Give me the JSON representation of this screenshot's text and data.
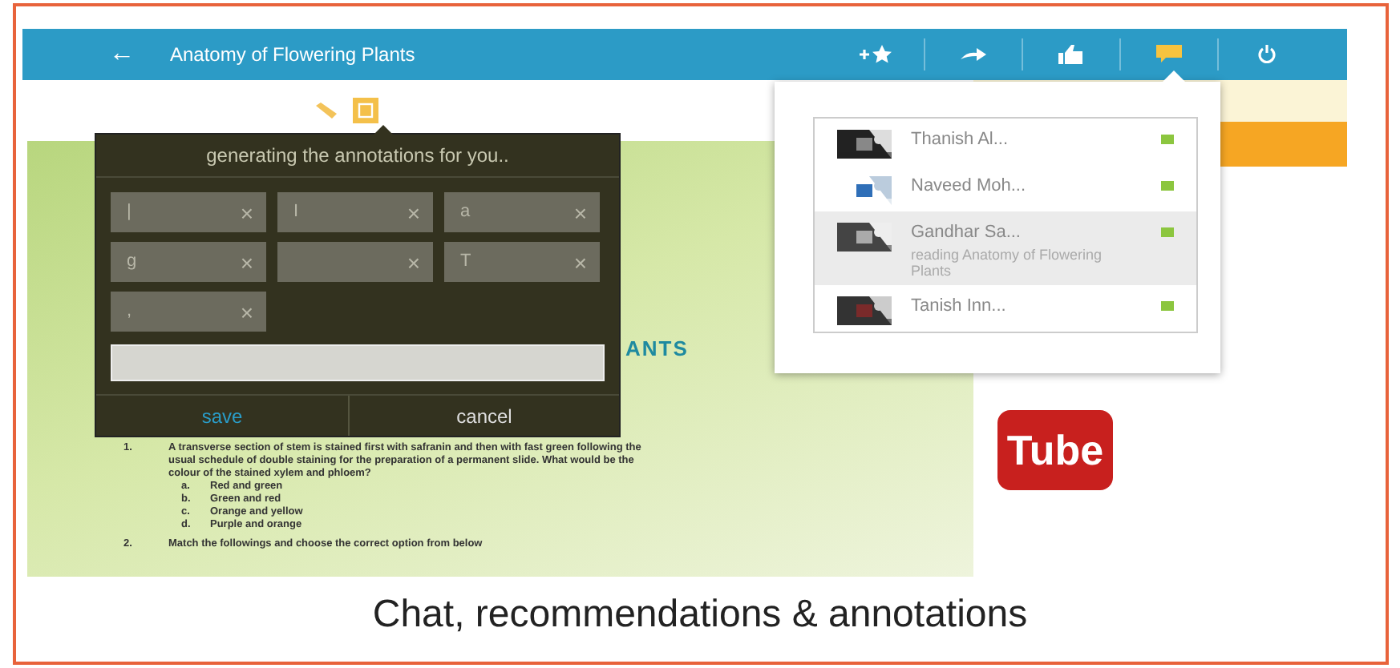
{
  "window": {
    "title": "Anatomy of Flowering Plants",
    "back": "←"
  },
  "toolbar": [
    {
      "kind": "bookmark",
      "selected": false
    },
    {
      "kind": "share",
      "selected": false
    },
    {
      "kind": "like",
      "selected": false
    },
    {
      "kind": "chat",
      "selected": true
    },
    {
      "kind": "power",
      "selected": false
    }
  ],
  "annotation_tools": [
    {
      "kind": "pencil",
      "selected": false
    },
    {
      "kind": "note",
      "selected": true
    }
  ],
  "document": {
    "heading_fragment": "ANTS",
    "questions": [
      {
        "number": "1.",
        "text": "A transverse section of stem is stained first with safranin and then with fast green following the usual schedule of double staining for the preparation of a permanent slide. What would be the colour of the stained xylem and phloem?",
        "options": [
          {
            "letter": "a.",
            "text": "Red and green"
          },
          {
            "letter": "b.",
            "text": "Green and red"
          },
          {
            "letter": "c.",
            "text": "Orange and yellow"
          },
          {
            "letter": "d.",
            "text": "Purple and orange"
          }
        ]
      },
      {
        "number": "2.",
        "text": "Match the followings and choose the correct option from below"
      }
    ]
  },
  "video_logo": "Tube",
  "annotation_dialog": {
    "title": "generating the annotations for you..",
    "chips": [
      {
        "label": "|",
        "close": "×"
      },
      {
        "label": "I",
        "close": "×"
      },
      {
        "label": "a",
        "close": "×"
      },
      {
        "label": "g",
        "close": "×"
      },
      {
        "close": "×"
      },
      {
        "label": "T",
        "close": "×"
      },
      {
        "label": ",",
        "close": "×"
      }
    ],
    "buttons": [
      {
        "label": "save",
        "kind": "primary"
      },
      {
        "label": "cancel",
        "kind": "secondary"
      }
    ]
  },
  "contacts": [
    {
      "name": "Thanish Al...",
      "online": true,
      "selected": false
    },
    {
      "name": "Naveed Moh...",
      "online": true,
      "selected": false
    },
    {
      "name": "Gandhar Sa...",
      "status": "reading Anatomy of Flowering Plants",
      "online": true,
      "selected": true
    },
    {
      "name": "Tanish Inn...",
      "online": true,
      "selected": false
    }
  ],
  "caption": "Chat, recommendations & annotations"
}
